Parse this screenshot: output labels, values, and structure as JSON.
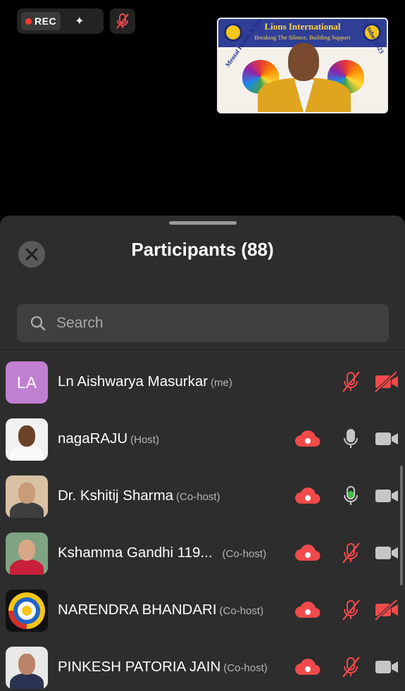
{
  "top_bar": {
    "rec_label": "REC"
  },
  "video_tile": {
    "banner_title": "Lions International",
    "banner_subtitle": "Breaking The Silence, Building Support",
    "left_arc_text": "Mental Health & Wellbeing",
    "right_arc_text": "Service Week 4-12 October 2023"
  },
  "sheet": {
    "title": "Participants (88)",
    "search_placeholder": "Search"
  },
  "participants": [
    {
      "initials": "LA",
      "name": "Ln Aishwarya Masurkar",
      "role": "(me)",
      "recording": false,
      "mic": "muted",
      "camera": "off",
      "avatar": "initials",
      "avatar_color": "#c07fd1"
    },
    {
      "name": "nagaRAJU",
      "role": "(Host)",
      "recording": true,
      "mic": "on",
      "camera": "on",
      "avatar": "photo"
    },
    {
      "name": "Dr. Kshitij Sharma",
      "role": "(Co-host)",
      "recording": true,
      "mic": "speaking",
      "camera": "on",
      "avatar": "photo"
    },
    {
      "name": "Kshamma Gandhi 119...",
      "role": "(Co-host)",
      "recording": true,
      "mic": "muted",
      "camera": "on",
      "avatar": "photo"
    },
    {
      "name": "NARENDRA BHANDARI",
      "role": "(Co-host)",
      "recording": true,
      "mic": "muted",
      "camera": "off",
      "avatar": "logo"
    },
    {
      "name": "PINKESH PATORIA JAIN",
      "role": "(Co-host)",
      "recording": true,
      "mic": "muted",
      "camera": "on",
      "avatar": "photo"
    }
  ],
  "colors": {
    "muted_red": "#f24a4a",
    "speaking_green": "#3fbf3f",
    "icon_gray": "#c6c6c6",
    "sheet_bg": "#2d2d2d"
  }
}
